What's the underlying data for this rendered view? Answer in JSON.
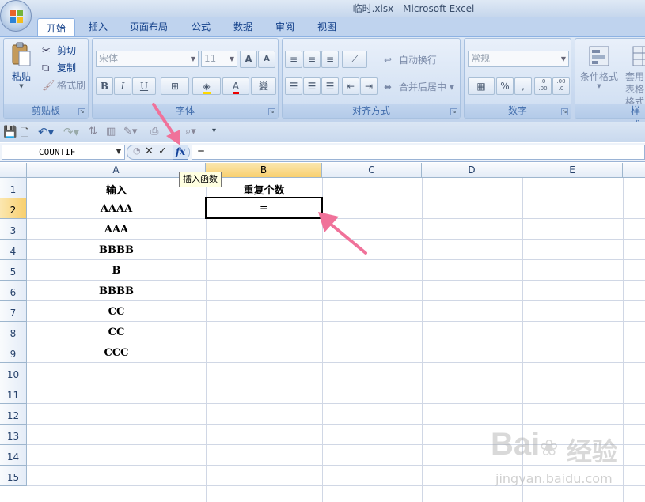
{
  "window": {
    "title": "临时.xlsx - Microsoft Excel"
  },
  "tabs": [
    "开始",
    "插入",
    "页面布局",
    "公式",
    "数据",
    "审阅",
    "视图"
  ],
  "ribbon": {
    "clipboard": {
      "label": "剪贴板",
      "paste": "粘贴",
      "cut": "剪切",
      "copy": "复制",
      "format_painter": "格式刷"
    },
    "font": {
      "label": "字体",
      "font_name": "宋体",
      "font_size": "11",
      "bold": "B",
      "italic": "I",
      "underline": "U",
      "grow": "A",
      "shrink": "A",
      "font_color": "A",
      "phonetic": "變"
    },
    "alignment": {
      "label": "对齐方式",
      "wrap_text": "自动换行",
      "merge_center": "合并后居中"
    },
    "number": {
      "label": "数字",
      "format": "常规",
      "percent": "%",
      "comma": ",",
      "inc_dec": ".0 .00",
      "dec_dec": ".00 .0"
    },
    "styles": {
      "label": "样式",
      "conditional": "条件格式",
      "table_format": "套用表格格式"
    }
  },
  "formula_bar": {
    "name_box": "COUNTIF",
    "fx": "fx",
    "formula": "="
  },
  "tooltip": "插入函数",
  "columns": [
    "A",
    "B",
    "C",
    "D",
    "E"
  ],
  "rows": [
    "1",
    "2",
    "3",
    "4",
    "5",
    "6",
    "7",
    "8",
    "9",
    "10",
    "11",
    "12",
    "13",
    "14",
    "15"
  ],
  "cells": {
    "A": [
      "输入",
      "AAAA",
      "AAA",
      "BBBB",
      "B",
      "BBBB",
      "CC",
      "CC",
      "CCC"
    ],
    "B1": "重复个数",
    "B2": "="
  },
  "watermark": {
    "brand_en": "Bai",
    "brand_cn": "经验",
    "url": "jingyan.baidu.com"
  },
  "colors": {
    "accent": "#15428b",
    "arrow": "#f0729a",
    "selected_header": "#f8cf6e"
  }
}
